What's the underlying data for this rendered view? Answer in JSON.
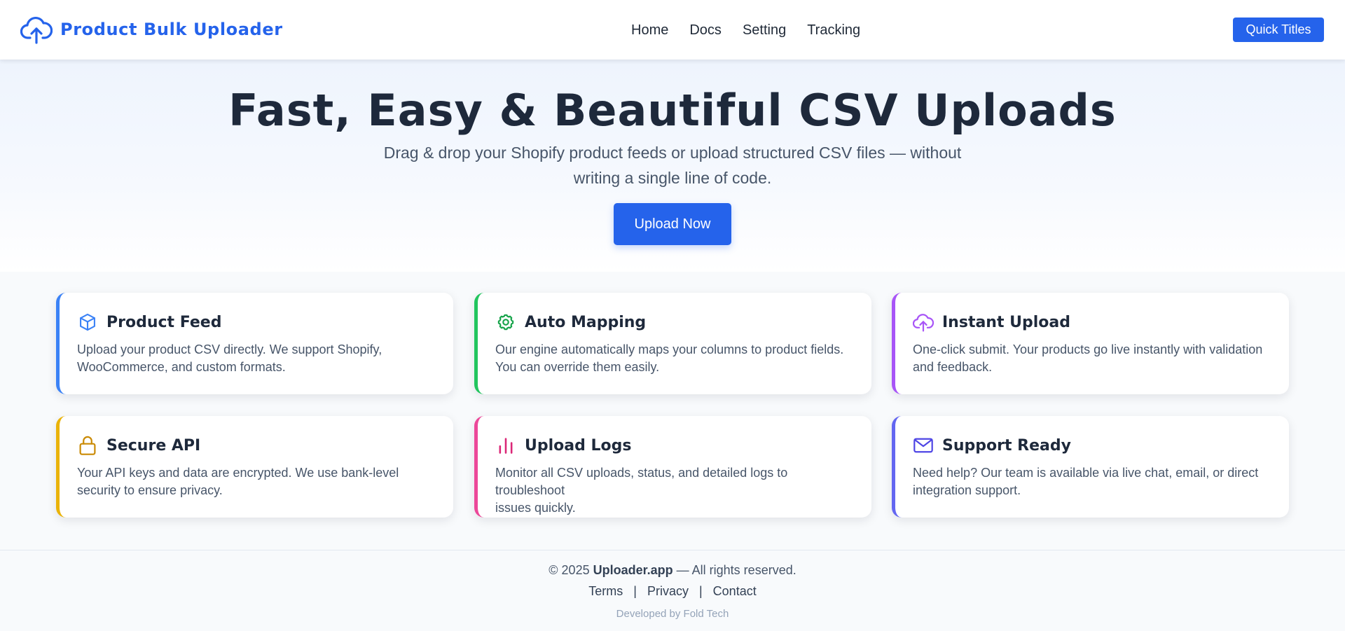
{
  "header": {
    "brand": {
      "title": "Product Bulk Uploader",
      "icon": "cloud-upload-icon",
      "color": "#2563eb"
    },
    "nav": [
      "Home",
      "Docs",
      "Setting",
      "Tracking"
    ],
    "quick_button": "Quick Titles"
  },
  "hero": {
    "title": "Fast, Easy & Beautiful CSV Uploads",
    "subtitle_line1": "Drag & drop your Shopify product feeds or upload structured CSV files — without",
    "subtitle_line2": "writing a single line of code.",
    "cta": "Upload Now"
  },
  "features": [
    {
      "title": "Product Feed",
      "icon": "box-icon",
      "accent": "#3b82f6",
      "line1": "Upload your product CSV directly. We support Shopify,",
      "line2": "WooCommerce, and custom formats."
    },
    {
      "title": "Auto Mapping",
      "icon": "gear-icon",
      "accent": "#22c55e",
      "line1": "Our engine automatically maps your columns to product fields.",
      "line2": "You can override them easily."
    },
    {
      "title": "Instant Upload",
      "icon": "cloud-upload-icon",
      "accent": "#a855f7",
      "line1": "One-click submit. Your products go live instantly with validation",
      "line2": "and feedback."
    },
    {
      "title": "Secure API",
      "icon": "lock-icon",
      "accent": "#eab308",
      "line1": "Your API keys and data are encrypted. We use bank-level",
      "line2": "security to ensure privacy."
    },
    {
      "title": "Upload Logs",
      "icon": "bar-chart-icon",
      "accent": "#ec4899",
      "line1": "Monitor all CSV uploads, status, and detailed logs to troubleshoot",
      "line2": "issues quickly."
    },
    {
      "title": "Support Ready",
      "icon": "mail-icon",
      "accent": "#6366f1",
      "line1": "Need help? Our team is available via live chat, email, or direct",
      "line2": "integration support."
    }
  ],
  "footer": {
    "copyright_prefix": "© 2025",
    "site": "Uploader.app",
    "copyright_suffix": "— All rights reserved.",
    "links": [
      "Terms",
      "Privacy",
      "Contact"
    ],
    "separator": "|",
    "developed_by": "Developed by Fold Tech"
  }
}
